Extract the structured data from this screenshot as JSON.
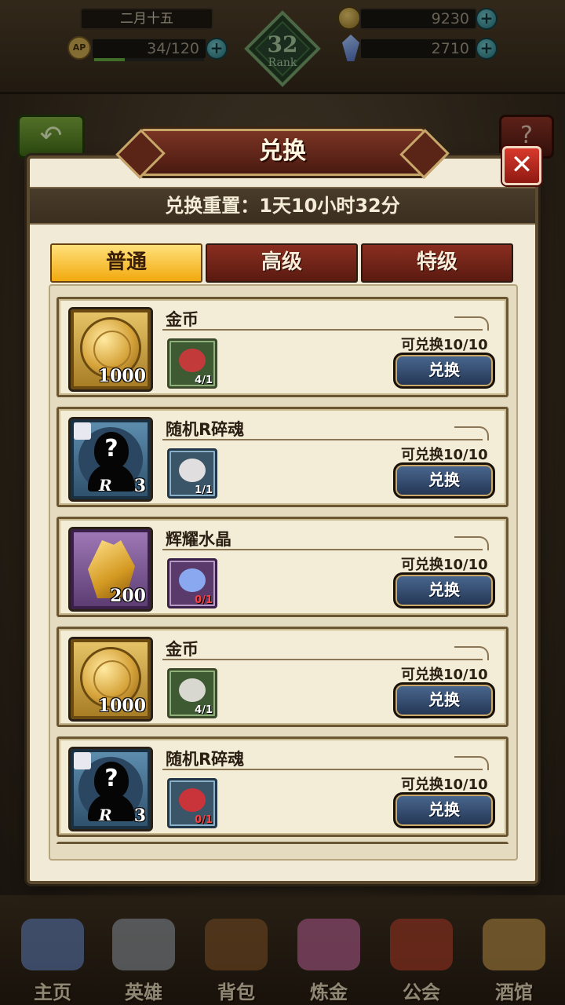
{
  "hud": {
    "date": "二月十五",
    "stamina": "34/120",
    "stamina_fill": 0.28,
    "stamina_icon": "AP",
    "rank_number": "32",
    "rank_label": "Rank",
    "gold": "9230",
    "crystal": "2710",
    "plus_symbol": "+"
  },
  "nav_buttons": {
    "back_icon": "back-arrow-icon",
    "back_glyph": "↶",
    "help_glyph": "?"
  },
  "modal": {
    "title": "兑换",
    "close_glyph": "✕",
    "reset_text": "兑换重置：1天10小时32分",
    "tabs": [
      {
        "label": "普通",
        "active": true
      },
      {
        "label": "高级",
        "active": false
      },
      {
        "label": "特级",
        "active": false
      }
    ],
    "items": [
      {
        "name": "金币",
        "icon": "gold-coin-icon",
        "frame": "gold",
        "quantity": "1000",
        "cost_icon": "rose-bouquet-icon",
        "cost_count": "4/1",
        "cost_color": "#c23a3a",
        "cost_frame": "green",
        "cost_short": false,
        "limit": "可兑换10/10",
        "button": "兑换"
      },
      {
        "name": "随机R碎魂",
        "icon": "mystery-hero-icon",
        "frame": "blue",
        "quantity": "3",
        "cost_icon": "ticket-icon",
        "cost_count": "1/1",
        "cost_color": "#e0dede",
        "cost_frame": "blue",
        "cost_short": false,
        "limit": "可兑换10/10",
        "button": "兑换"
      },
      {
        "name": "辉耀水晶",
        "icon": "gold-crystal-icon",
        "frame": "purple",
        "quantity": "200",
        "cost_icon": "blue-rose-icon",
        "cost_count": "0/1",
        "cost_color": "#8aa8f0",
        "cost_frame": "purple",
        "cost_short": true,
        "limit": "可兑换10/10",
        "button": "兑换"
      },
      {
        "name": "金币",
        "icon": "gold-coin-icon",
        "frame": "gold",
        "quantity": "1000",
        "cost_icon": "newspaper-icon",
        "cost_count": "4/1",
        "cost_color": "#d8d8d0",
        "cost_frame": "green",
        "cost_short": false,
        "limit": "可兑换10/10",
        "button": "兑换"
      },
      {
        "name": "随机R碎魂",
        "icon": "mystery-hero-icon",
        "frame": "blue",
        "quantity": "3",
        "cost_icon": "red-ribbon-icon",
        "cost_count": "0/1",
        "cost_color": "#c8343a",
        "cost_frame": "blue",
        "cost_short": true,
        "limit": "可兑换10/10",
        "button": "兑换"
      }
    ],
    "silhouette_question": "?",
    "silhouette_rank": "R"
  },
  "bottom_nav": [
    {
      "label": "主页",
      "icon": "castle-icon",
      "color": "#6a8ac8"
    },
    {
      "label": "英雄",
      "icon": "helmet-icon",
      "color": "#9aa0a8"
    },
    {
      "label": "背包",
      "icon": "backpack-icon",
      "color": "#8a5a2a"
    },
    {
      "label": "炼金",
      "icon": "alchemy-flask-icon",
      "color": "#c86aa0"
    },
    {
      "label": "公会",
      "icon": "guild-shield-icon",
      "color": "#b8402a"
    },
    {
      "label": "酒馆",
      "icon": "beer-mug-icon",
      "color": "#c89a4a"
    }
  ]
}
